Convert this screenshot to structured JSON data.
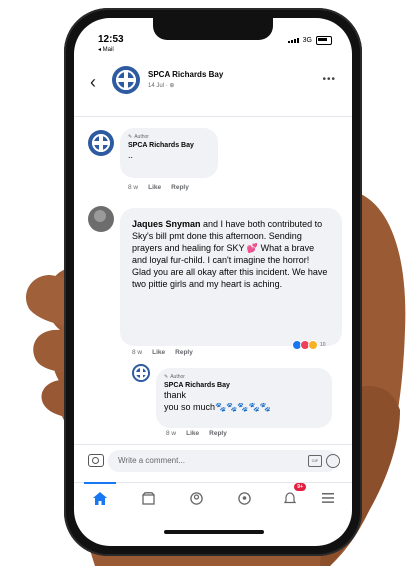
{
  "status": {
    "time": "12:53",
    "back_app": "◂ Mail",
    "network": "3G"
  },
  "header": {
    "page_name": "SPCA Richards Bay",
    "meta": "14 Jul · ⊕"
  },
  "comments": [
    {
      "author_tag": "Author",
      "name": "SPCA Richards Bay",
      "text": "..",
      "time": "8 w",
      "like": "Like",
      "reply": "Reply"
    },
    {
      "name": "Jaques Snyman",
      "text": " and I have both contributed to Sky's bill pmt done this afternoon. Sending prayers and healing for SKY 💕 What a brave and loyal fur-child. I can't imagine the horror! Glad you are all okay after this incident. We have two pittie girls and my heart is aching.",
      "time": "8 w",
      "like": "Like",
      "reply": "Reply",
      "reaction_count": "10"
    },
    {
      "author_tag": "Author",
      "name": "SPCA Richards Bay",
      "text_line1": "thank",
      "text_line2": "you so much🐾🐾🐾🐾🐾",
      "time": "8 w",
      "like": "Like",
      "reply": "Reply"
    }
  ],
  "composer": {
    "placeholder": "Write a comment...",
    "gif": "GIF"
  },
  "tabbar": {
    "notification_badge": "9+"
  },
  "colors": {
    "brand": "#1877f2",
    "logo": "#2d5aa0",
    "badge": "#e41e3f"
  }
}
